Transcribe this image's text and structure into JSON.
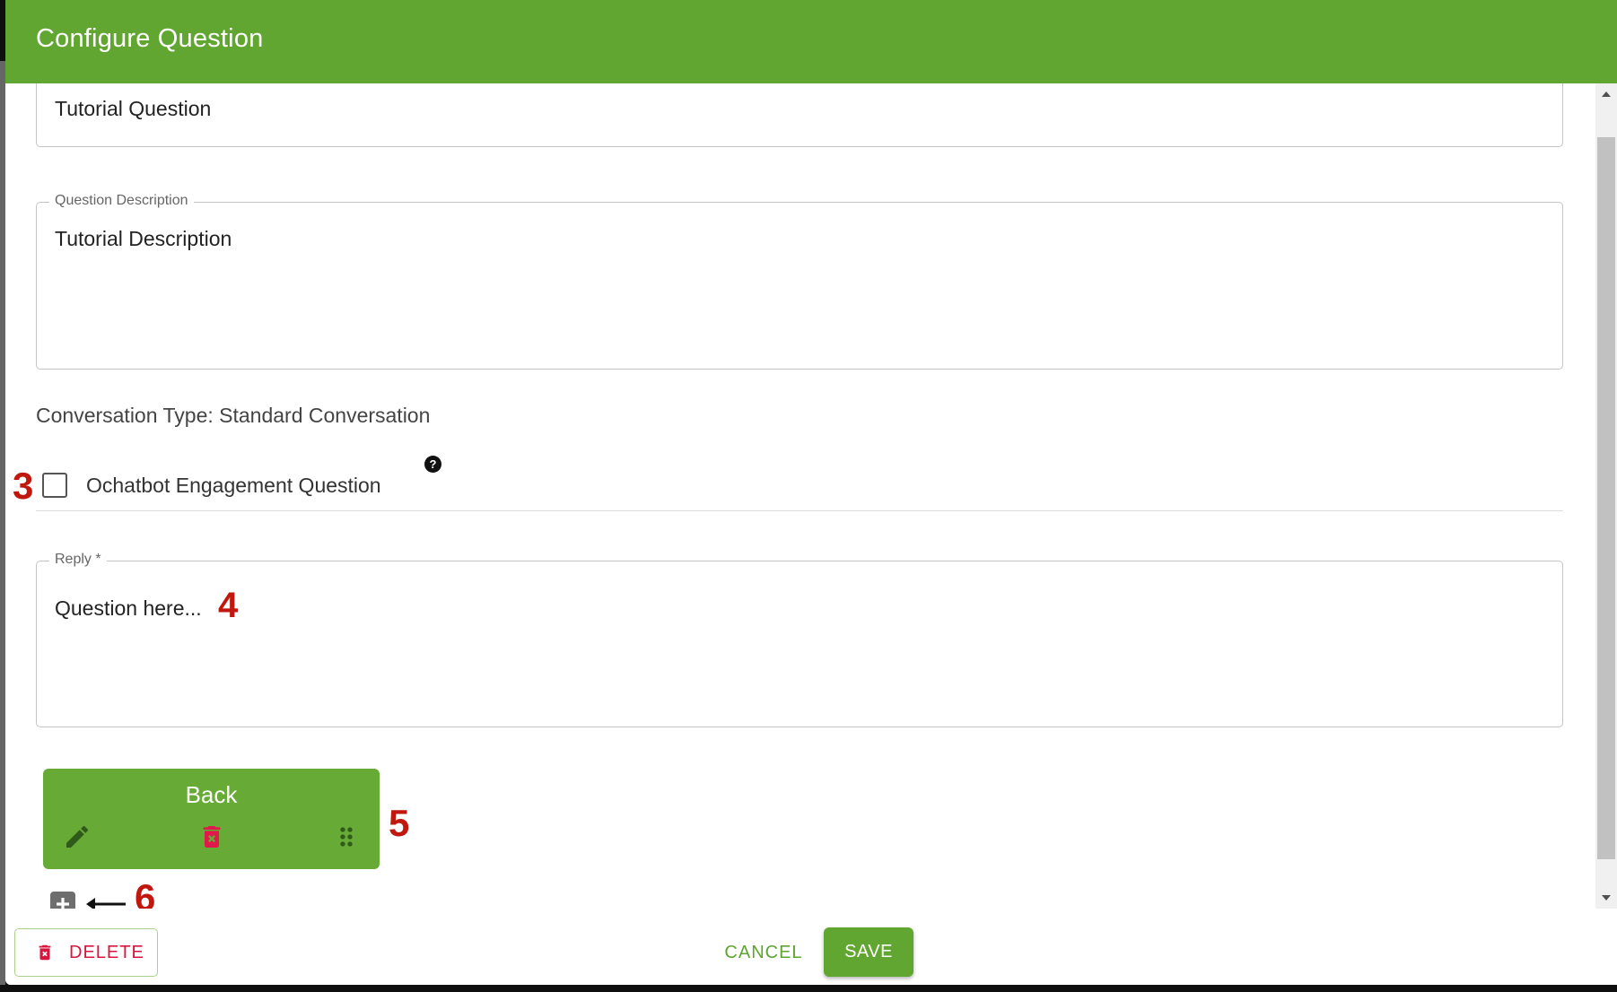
{
  "dialog": {
    "title": "Configure Question"
  },
  "form": {
    "question_title_value": "Tutorial Question",
    "description_label": "Question Description",
    "description_value": "Tutorial Description",
    "conversation_type": "Conversation Type: Standard Conversation",
    "engagement_checkbox_label": "Ochatbot Engagement Question",
    "engagement_checked": false,
    "reply_label": "Reply *",
    "reply_value": "Question here..."
  },
  "buttons_list": [
    {
      "label": "Back",
      "icons": [
        "edit-icon",
        "delete-icon",
        "drag-handle-icon"
      ]
    }
  ],
  "annotations": {
    "a3": "3",
    "a4": "4",
    "a5": "5",
    "a6": "6"
  },
  "footer": {
    "delete_label": "DELETE",
    "cancel_label": "CANCEL",
    "save_label": "SAVE"
  },
  "colors": {
    "primary_green": "#62a632",
    "danger_red": "#d6163f",
    "annotation_red": "#c0170f"
  }
}
